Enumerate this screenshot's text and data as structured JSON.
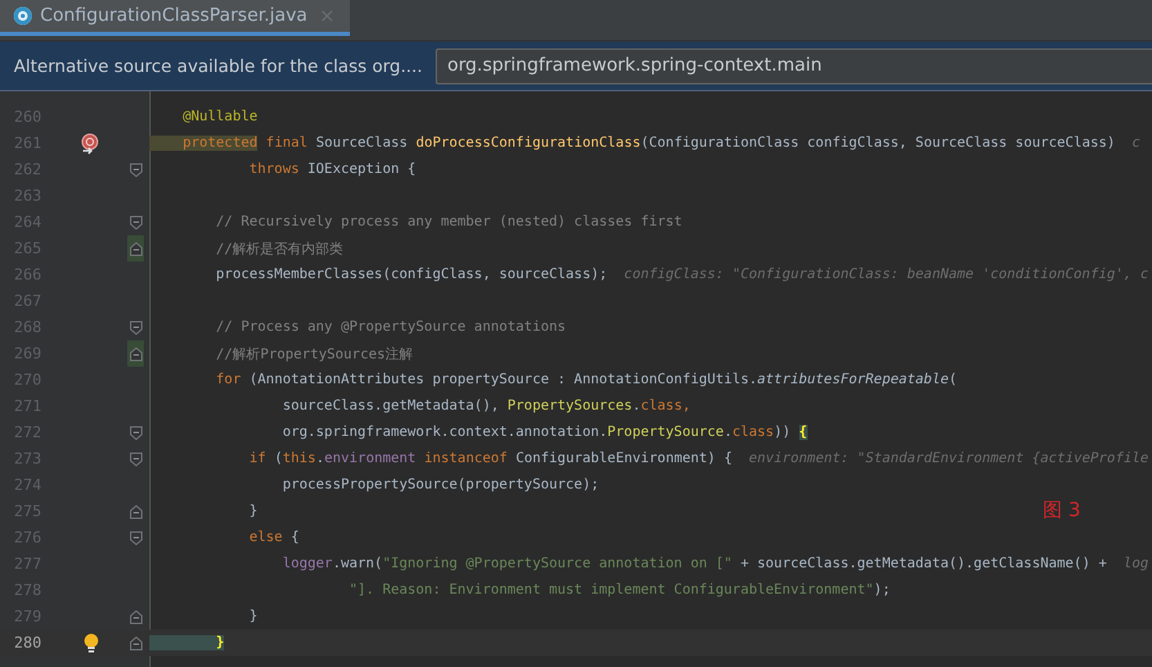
{
  "tabs": [
    {
      "title": "ConfigurationClassParser.java",
      "selected": true
    }
  ],
  "banner": {
    "message": "Alternative source available for the class org....",
    "field_value": "org.springframework.spring-context.main"
  },
  "figure_label": "图 3",
  "lines": [
    {
      "number": "260",
      "changed": false,
      "current": false,
      "tokens": [
        {
          "t": "    @Nullable",
          "kind": "annotation"
        }
      ]
    },
    {
      "number": "261",
      "changed": false,
      "current": false,
      "marker": {
        "kind": "method-breakpoint"
      },
      "tokens": [
        {
          "t": "    protected",
          "kind": "keyword-hl"
        },
        {
          "t": " final ",
          "kind": "keyword"
        },
        {
          "t": "SourceClass ",
          "kind": "plain"
        },
        {
          "t": "doProcessConfigurationClass",
          "kind": "method"
        },
        {
          "t": "(ConfigurationClass configClass, SourceClass sourceClass)",
          "kind": "plain"
        },
        {
          "t": "  c",
          "kind": "hint"
        }
      ]
    },
    {
      "number": "262",
      "fold": {
        "kind": "start"
      },
      "changed": false,
      "current": false,
      "tokens": [
        {
          "t": "            throws ",
          "kind": "keyword"
        },
        {
          "t": "IOException {",
          "kind": "plain"
        }
      ]
    },
    {
      "number": "263",
      "changed": false,
      "current": false
    },
    {
      "number": "264",
      "fold": {
        "kind": "start"
      },
      "changed": false,
      "current": false,
      "tokens": [
        {
          "t": "        // Recursively process any member (nested) classes first",
          "kind": "comment"
        }
      ]
    },
    {
      "number": "265",
      "fold": {
        "kind": "end"
      },
      "changed": true,
      "current": false,
      "tokens": [
        {
          "t": "        //解析是否有内部类",
          "kind": "comment"
        }
      ]
    },
    {
      "number": "266",
      "changed": false,
      "current": false,
      "tokens": [
        {
          "t": "        processMemberClasses(configClass, sourceClass);",
          "kind": "plain"
        },
        {
          "t": "  configClass: \"ConfigurationClass: beanName 'conditionConfig', c",
          "kind": "hint"
        }
      ]
    },
    {
      "number": "267",
      "changed": false,
      "current": false
    },
    {
      "number": "268",
      "fold": {
        "kind": "start"
      },
      "changed": false,
      "current": false,
      "tokens": [
        {
          "t": "        // Process any @PropertySource annotations",
          "kind": "comment"
        }
      ]
    },
    {
      "number": "269",
      "fold": {
        "kind": "end"
      },
      "changed": true,
      "current": false,
      "tokens": [
        {
          "t": "        //解析PropertySources注解",
          "kind": "comment"
        }
      ]
    },
    {
      "number": "270",
      "changed": false,
      "current": false,
      "tokens": [
        {
          "t": "        for",
          "kind": "keyword"
        },
        {
          "t": " (AnnotationAttributes propertySource : AnnotationConfigUtils.",
          "kind": "plain"
        },
        {
          "t": "attributesForRepeatable",
          "kind": "static"
        },
        {
          "t": "(",
          "kind": "plain"
        }
      ]
    },
    {
      "number": "271",
      "changed": false,
      "current": false,
      "tokens": [
        {
          "t": "                sourceClass.getMetadata(), ",
          "kind": "plain"
        },
        {
          "t": "PropertySources",
          "kind": "type-hl"
        },
        {
          "t": ".",
          "kind": "plain"
        },
        {
          "t": "class,",
          "kind": "keyword"
        }
      ]
    },
    {
      "number": "272",
      "fold": {
        "kind": "start"
      },
      "changed": false,
      "current": false,
      "tokens": [
        {
          "t": "                org.springframework.context.annotation.",
          "kind": "plain"
        },
        {
          "t": "PropertySource",
          "kind": "type-hl"
        },
        {
          "t": ".",
          "kind": "plain"
        },
        {
          "t": "class",
          "kind": "keyword"
        },
        {
          "t": ")) ",
          "kind": "plain"
        },
        {
          "t": "{",
          "kind": "brace-match"
        }
      ]
    },
    {
      "number": "273",
      "fold": {
        "kind": "start"
      },
      "changed": false,
      "current": false,
      "tokens": [
        {
          "t": "            if",
          "kind": "keyword"
        },
        {
          "t": " (",
          "kind": "plain"
        },
        {
          "t": "this",
          "kind": "keyword"
        },
        {
          "t": ".",
          "kind": "plain"
        },
        {
          "t": "environment",
          "kind": "field"
        },
        {
          "t": " instanceof ",
          "kind": "keyword"
        },
        {
          "t": "ConfigurableEnvironment) {",
          "kind": "plain"
        },
        {
          "t": "  environment: \"StandardEnvironment {activeProfile",
          "kind": "hint"
        }
      ]
    },
    {
      "number": "274",
      "changed": false,
      "current": false,
      "tokens": [
        {
          "t": "                processPropertySource(propertySource);",
          "kind": "plain"
        }
      ]
    },
    {
      "number": "275",
      "fold": {
        "kind": "end"
      },
      "changed": false,
      "current": false,
      "tokens": [
        {
          "t": "            }",
          "kind": "plain"
        }
      ]
    },
    {
      "number": "276",
      "fold": {
        "kind": "start"
      },
      "changed": false,
      "current": false,
      "tokens": [
        {
          "t": "            else",
          "kind": "keyword"
        },
        {
          "t": " {",
          "kind": "plain"
        }
      ]
    },
    {
      "number": "277",
      "changed": false,
      "current": false,
      "tokens": [
        {
          "t": "                logger",
          "kind": "field"
        },
        {
          "t": ".warn(",
          "kind": "plain"
        },
        {
          "t": "\"Ignoring @PropertySource annotation on [\"",
          "kind": "string"
        },
        {
          "t": " + sourceClass.getMetadata().getClassName() +",
          "kind": "plain"
        },
        {
          "t": "  log",
          "kind": "hint"
        }
      ]
    },
    {
      "number": "278",
      "changed": false,
      "current": false,
      "tokens": [
        {
          "t": "                        \"]. Reason: Environment must implement ConfigurableEnvironment\"",
          "kind": "string"
        },
        {
          "t": ");",
          "kind": "plain"
        }
      ]
    },
    {
      "number": "279",
      "fold": {
        "kind": "end"
      },
      "changed": false,
      "current": false,
      "tokens": [
        {
          "t": "            }",
          "kind": "plain"
        }
      ]
    },
    {
      "number": "280",
      "fold": {
        "kind": "end"
      },
      "changed": false,
      "current": true,
      "marker": {
        "kind": "bulb"
      },
      "tokens": [
        {
          "t": "        }",
          "kind": "brace-match"
        }
      ]
    }
  ]
}
